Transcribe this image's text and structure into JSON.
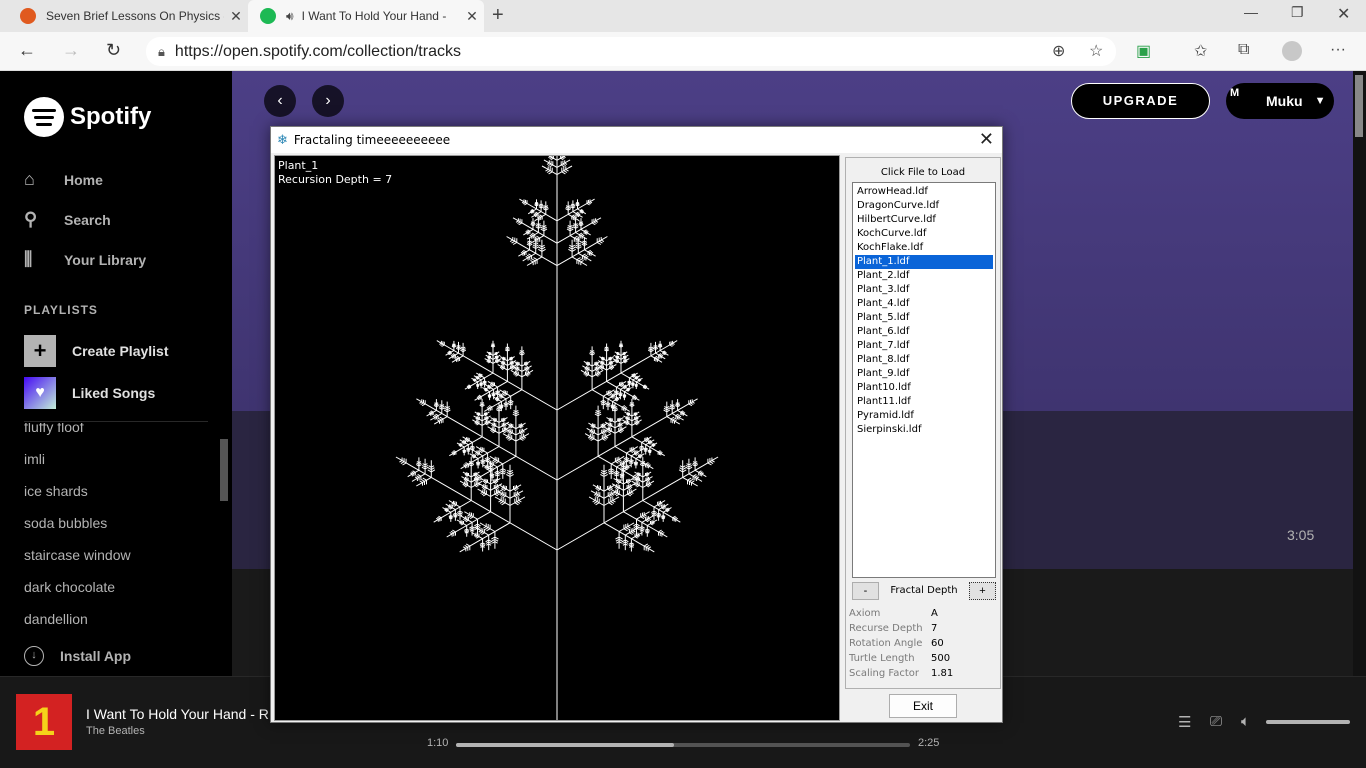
{
  "browser": {
    "tabs": [
      {
        "title": "Seven Brief Lessons On Physics -",
        "favicon_color": "#e05a1f"
      },
      {
        "title": "I Want To Hold Your Hand -",
        "favicon_color": "#1db954"
      }
    ],
    "url": "https://open.spotify.com/collection/tracks"
  },
  "spotify": {
    "logo_text": "Spotify",
    "nav": [
      {
        "label": "Home",
        "icon": "home-icon"
      },
      {
        "label": "Search",
        "icon": "search-icon"
      },
      {
        "label": "Your Library",
        "icon": "library-icon"
      }
    ],
    "playlists_header": "PLAYLISTS",
    "create_playlist": "Create Playlist",
    "liked_songs": "Liked Songs",
    "playlists": [
      "fluffy floof",
      "imli",
      "ice shards",
      "soda bubbles",
      "staircase window",
      "dark chocolate",
      "dandellion"
    ],
    "install_app": "Install App",
    "upgrade": "UPGRADE",
    "user": "Muku",
    "avatar_alt": "M",
    "track_duration": "3:05"
  },
  "player": {
    "title": "I Want To Hold Your Hand - R",
    "artist": "The Beatles",
    "elapsed": "1:10",
    "total": "2:25",
    "progress": 0.48,
    "volume": 1.0,
    "cover_text": "1"
  },
  "dialog": {
    "title": "Fractaling timeeeeeeeeee",
    "canvas_name": "Plant_1",
    "canvas_depth": "Recursion Depth = 7",
    "panel_header": "Click File to Load",
    "files": [
      "ArrowHead.ldf",
      "DragonCurve.ldf",
      "HilbertCurve.ldf",
      "KochCurve.ldf",
      "KochFlake.ldf",
      "Plant_1.ldf",
      "Plant_2.ldf",
      "Plant_3.ldf",
      "Plant_4.ldf",
      "Plant_5.ldf",
      "Plant_6.ldf",
      "Plant_7.ldf",
      "Plant_8.ldf",
      "Plant_9.ldf",
      "Plant10.ldf",
      "Plant11.ldf",
      "Pyramid.ldf",
      "Sierpinski.ldf"
    ],
    "selected_file": "Plant_1.ldf",
    "depth_minus": "-",
    "depth_plus": "+",
    "depth_label": "Fractal Depth",
    "info": [
      {
        "key": "Axiom",
        "value": "A"
      },
      {
        "key": "Recurse Depth",
        "value": "7"
      },
      {
        "key": "Rotation Angle",
        "value": "60"
      },
      {
        "key": "Turtle Length",
        "value": "500"
      },
      {
        "key": "Scaling Factor",
        "value": "1.81"
      }
    ],
    "exit": "Exit"
  }
}
